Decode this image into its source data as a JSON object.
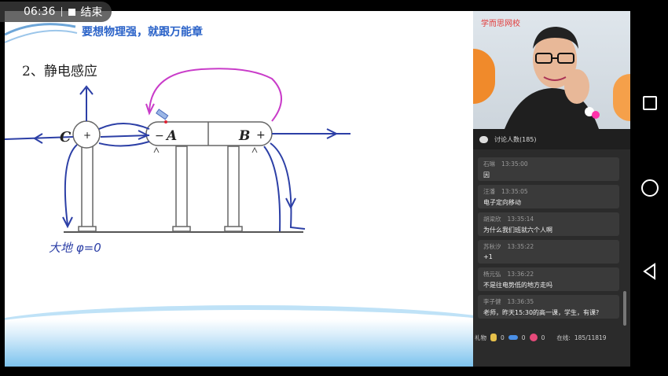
{
  "status": {
    "time": "06:36",
    "end_label": "结束"
  },
  "board": {
    "slogan": "要想物理强，就跟万能章",
    "section_title": "2、静电感应",
    "ground_label": "大地 φ=0",
    "labels": {
      "C": "C",
      "A": "A",
      "B": "B",
      "plus_c": "+",
      "minus_a": "−",
      "plus_b": "+"
    }
  },
  "video": {
    "logo": "学而思网校"
  },
  "chat": {
    "header": "讨论人数(185)",
    "messages": [
      {
        "user": "石琳",
        "time": "13:35:00",
        "text": "因"
      },
      {
        "user": "汪潘",
        "time": "13:35:05",
        "text": "电子定向移动"
      },
      {
        "user": "胡梁欣",
        "time": "13:35:14",
        "text": "为什么我们班就六个人啊"
      },
      {
        "user": "苏秋汐",
        "time": "13:35:22",
        "text": "+1"
      },
      {
        "user": "杨元弘",
        "time": "13:36:22",
        "text": "不是往电势低的地方走吗"
      },
      {
        "user": "李子健",
        "time": "13:36:35",
        "text": "老师，昨天15:30的高一课，学生，有课?"
      }
    ]
  },
  "gifts": {
    "label": "礼物",
    "counts": [
      "0",
      "0",
      "0"
    ],
    "online_label": "在线:",
    "online_value": "185/11819"
  },
  "colors": {
    "accent_blue": "#2a62c8",
    "pen_blue": "#2c3fa6",
    "pen_magenta": "#c93cc9",
    "panel_bg": "#2b2b2b"
  }
}
